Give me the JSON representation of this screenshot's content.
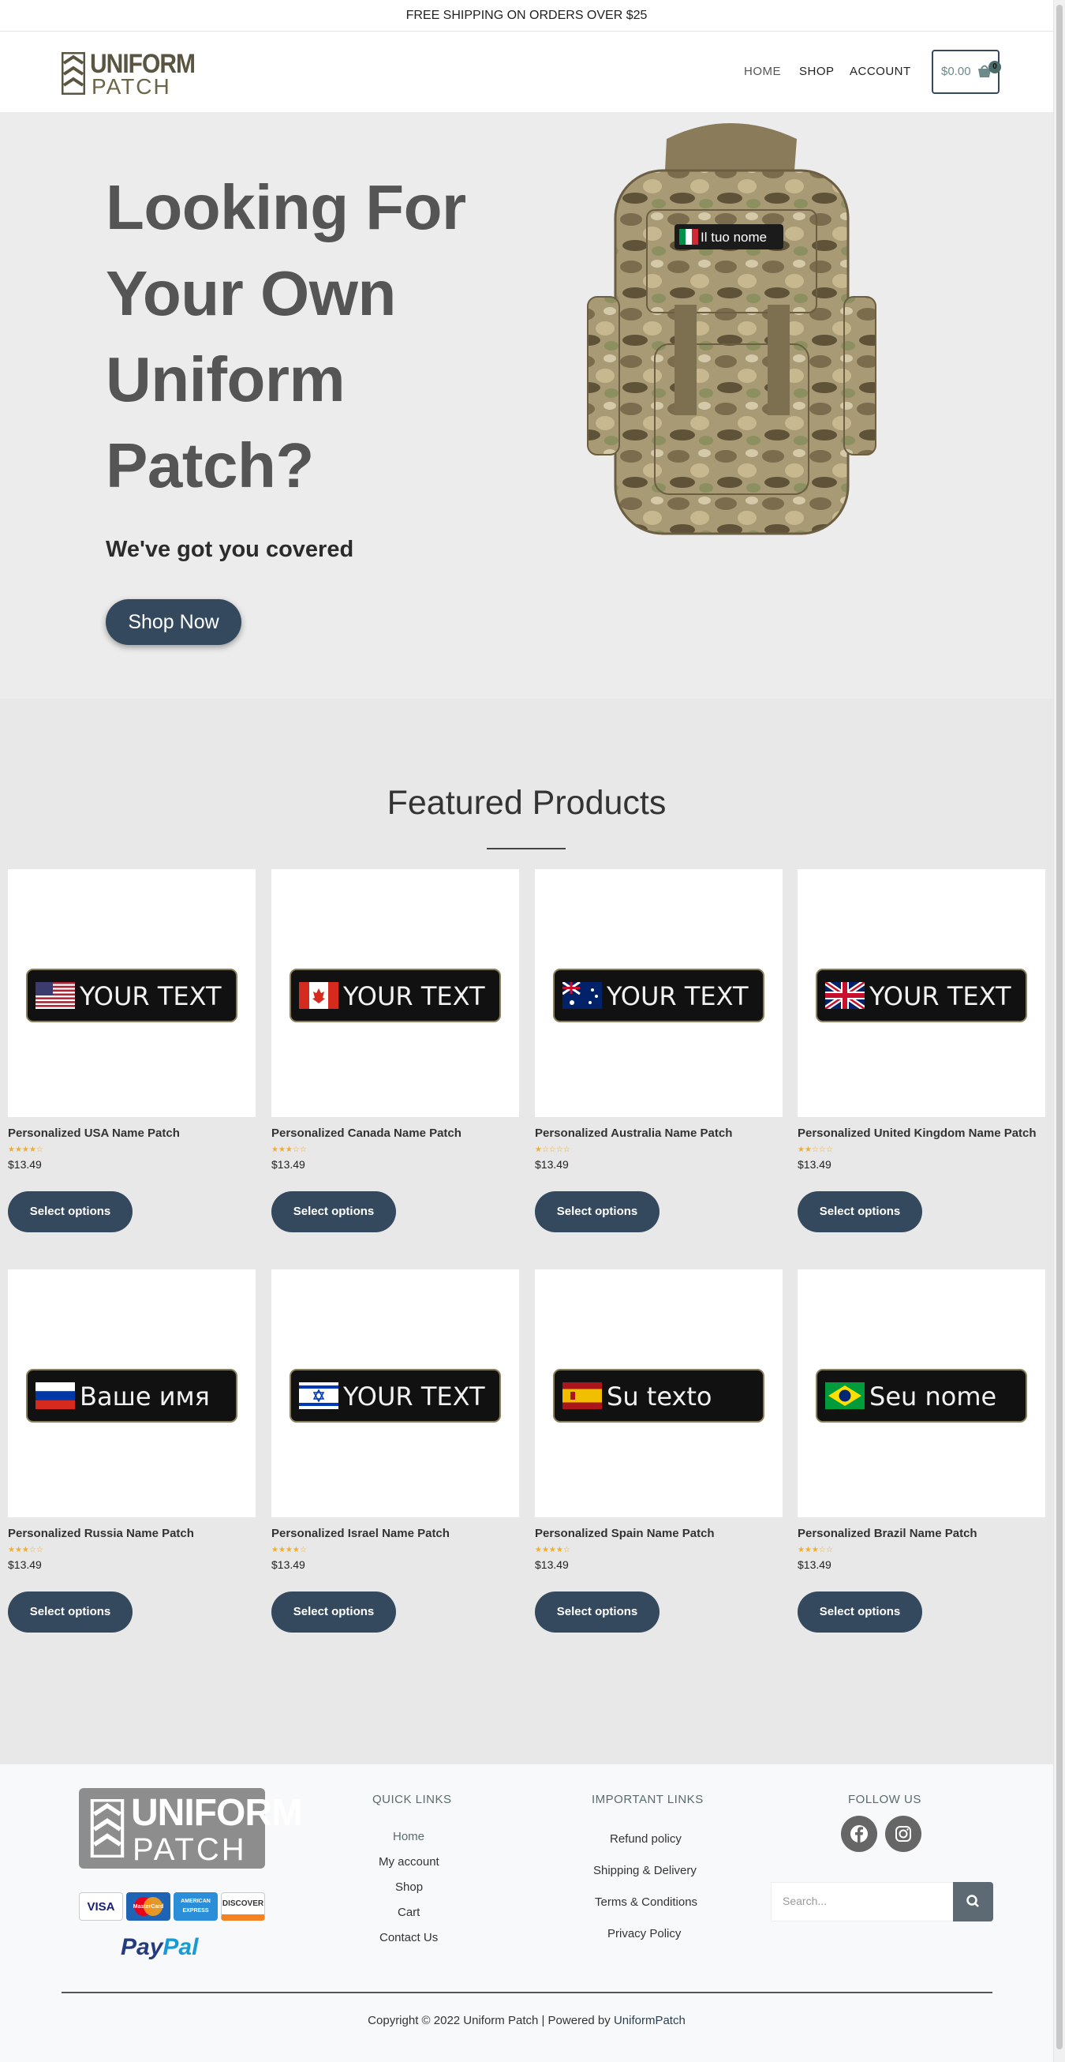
{
  "topbar": {
    "text": "FREE SHIPPING ON ORDERS OVER $25"
  },
  "header": {
    "logo_top": "UNIFORM",
    "logo_bottom": "PATCH",
    "nav": [
      {
        "label": "HOME"
      },
      {
        "label": "SHOP"
      },
      {
        "label": "ACCOUNT"
      }
    ],
    "cart_amount": "$0.00",
    "cart_count": "0"
  },
  "hero": {
    "heading": "Looking For Your Own Uniform Patch?",
    "subheading": "We've got you covered",
    "button": "Shop Now",
    "backpack_patch_text": "Il tuo nome"
  },
  "featured": {
    "title": "Featured Products",
    "products": [
      {
        "title": "Personalized USA Name Patch",
        "price": "$13.49",
        "rating": 0.8,
        "button": "Select options",
        "patch_text": "YOUR TEXT",
        "flag": "us-flag"
      },
      {
        "title": "Personalized Canada Name Patch",
        "price": "$13.49",
        "rating": 0.7,
        "button": "Select options",
        "patch_text": "YOUR TEXT",
        "flag": "ca-flag"
      },
      {
        "title": "Personalized Australia Name Patch",
        "price": "$13.49",
        "rating": 0.3,
        "button": "Select options",
        "patch_text": "YOUR TEXT",
        "flag": "au-flag"
      },
      {
        "title": "Personalized United Kingdom Name Patch",
        "price": "$13.49",
        "rating": 0.4,
        "button": "Select options",
        "patch_text": "YOUR TEXT",
        "flag": "uk-flag"
      },
      {
        "title": "Personalized Russia Name Patch",
        "price": "$13.49",
        "rating": 0.7,
        "button": "Select options",
        "patch_text": "Ваше имя",
        "flag": "ru-flag"
      },
      {
        "title": "Personalized Israel Name Patch",
        "price": "$13.49",
        "rating": 0.8,
        "button": "Select options",
        "patch_text": "YOUR TEXT",
        "flag": "il-flag"
      },
      {
        "title": "Personalized Spain Name Patch",
        "price": "$13.49",
        "rating": 0.9,
        "button": "Select options",
        "patch_text": "Su texto",
        "flag": "es-flag"
      },
      {
        "title": "Personalized Brazil Name Patch",
        "price": "$13.49",
        "rating": 0.6,
        "button": "Select options",
        "patch_text": "Seu nome",
        "flag": "br-flag"
      }
    ]
  },
  "footer": {
    "logo_top": "UNIFORM",
    "logo_bottom": "PATCH",
    "payment": [
      "VISA",
      "MasterCard",
      "AMERICAN EXPRESS",
      "DISCOVER"
    ],
    "paypal_a": "Pay",
    "paypal_b": "Pal",
    "quick_links_title": "QUICK LINKS",
    "quick_links": [
      "Home",
      "My account",
      "Shop",
      "Cart",
      "Contact Us"
    ],
    "important_links_title": "IMPORTANT LINKS",
    "important_links": [
      "Refund policy",
      "Shipping & Delivery",
      "Terms & Conditions",
      "Privacy Policy"
    ],
    "follow_title": "FOLLOW US",
    "search_placeholder": "Search...",
    "copyright": "Copyright © 2022 Uniform Patch | Powered by ",
    "copyright_brand": "UniformPatch"
  }
}
